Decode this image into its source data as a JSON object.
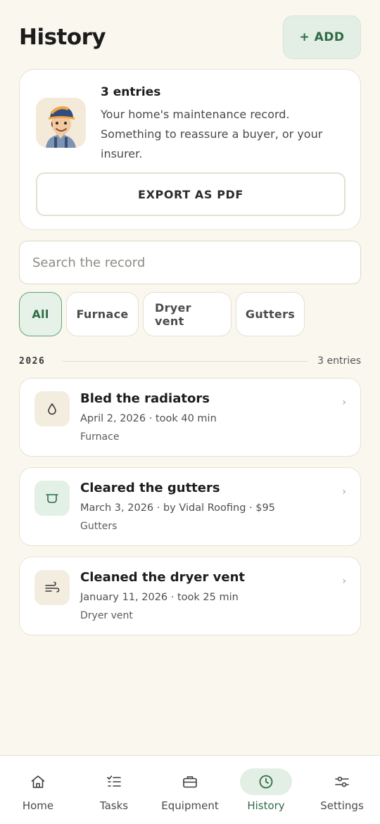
{
  "header": {
    "title": "History",
    "add_label": "+ ADD"
  },
  "summary": {
    "count": "3 entries",
    "description": "Your home's maintenance record. Something to reassure a buyer, or your insurer.",
    "export_label": "EXPORT AS PDF"
  },
  "search": {
    "placeholder": "Search the record",
    "value": ""
  },
  "filters": [
    {
      "label": "All",
      "active": true
    },
    {
      "label": "Furnace",
      "active": false
    },
    {
      "label": "Dryer vent",
      "active": false
    },
    {
      "label": "Gutters",
      "active": false
    }
  ],
  "year_group": {
    "year": "2026",
    "count": "3 entries"
  },
  "entries": [
    {
      "title": "Bled the radiators",
      "meta": "April 2, 2026 · took 40 min",
      "tag": "Furnace",
      "icon": "drop-icon"
    },
    {
      "title": "Cleared the gutters",
      "meta": "March 3, 2026 · by Vidal Roofing · $95",
      "tag": "Gutters",
      "icon": "gutter-icon"
    },
    {
      "title": "Cleaned the dryer vent",
      "meta": "January 11, 2026 · took 25 min",
      "tag": "Dryer vent",
      "icon": "wind-icon"
    }
  ],
  "nav": [
    {
      "label": "Home",
      "icon": "home-icon"
    },
    {
      "label": "Tasks",
      "icon": "tasks-icon"
    },
    {
      "label": "Equipment",
      "icon": "toolbox-icon"
    },
    {
      "label": "History",
      "icon": "clock-icon",
      "active": true
    },
    {
      "label": "Settings",
      "icon": "sliders-icon"
    }
  ],
  "colors": {
    "accent": "#2f6b47",
    "accent_bg": "#e3efe4",
    "background": "#faf7ef"
  }
}
